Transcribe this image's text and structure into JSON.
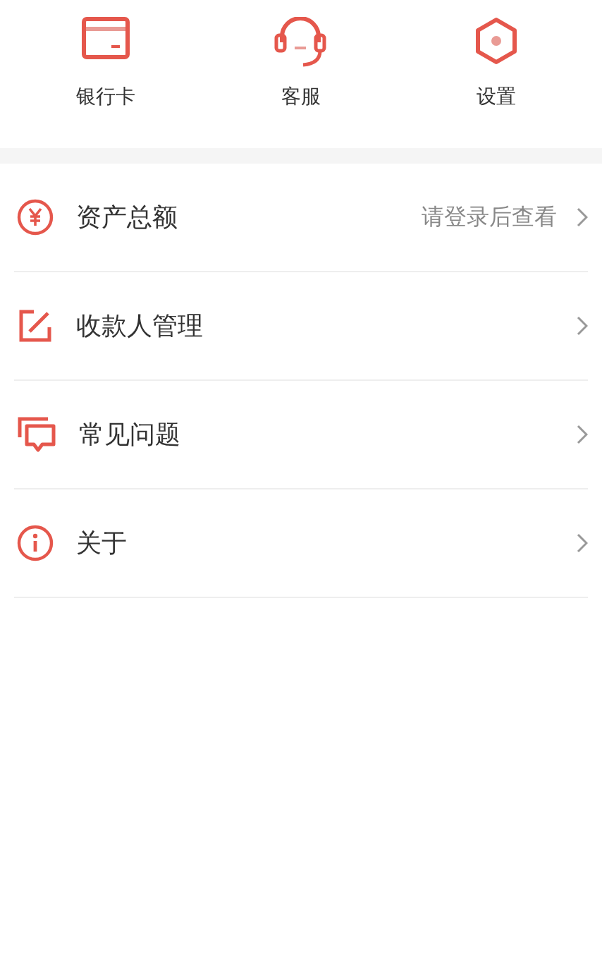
{
  "shortcuts": [
    {
      "kind": "card",
      "label": "银行卡"
    },
    {
      "kind": "headset",
      "label": "客服"
    },
    {
      "kind": "settings",
      "label": "设置"
    }
  ],
  "menu": [
    {
      "kind": "yuan",
      "label": "资产总额",
      "value": "请登录后查看"
    },
    {
      "kind": "edit",
      "label": "收款人管理"
    },
    {
      "kind": "chat",
      "label": "常见问题"
    },
    {
      "kind": "info",
      "label": "关于"
    }
  ]
}
